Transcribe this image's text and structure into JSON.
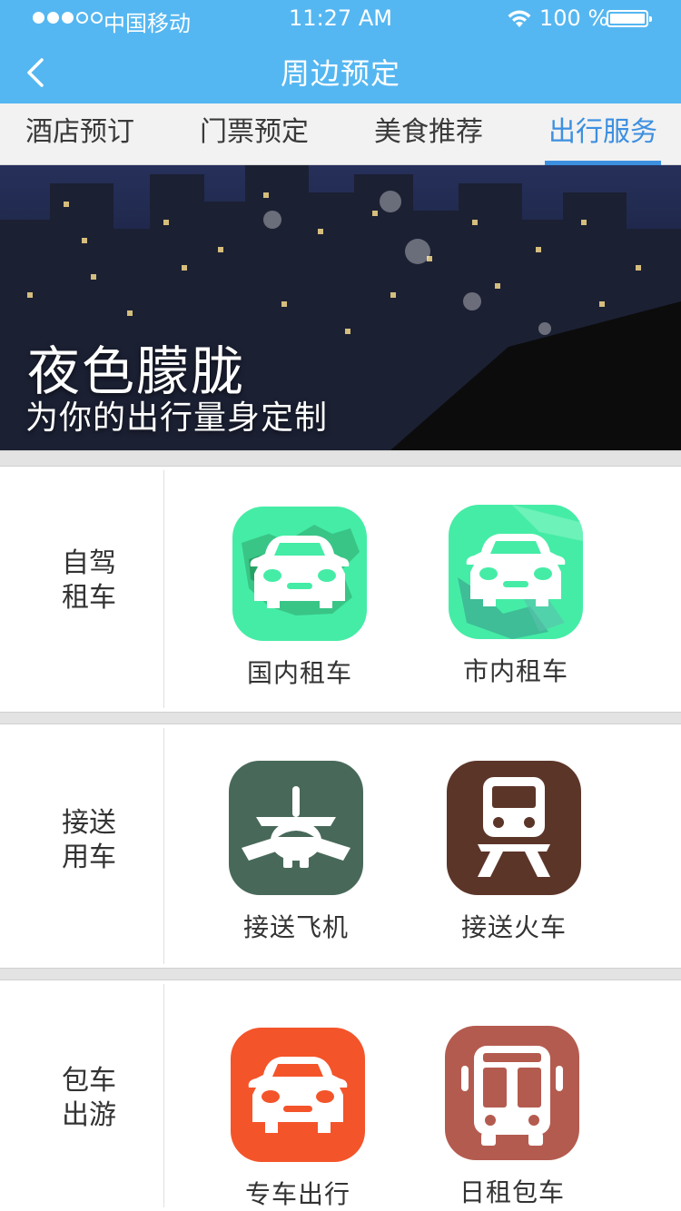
{
  "status": {
    "carrier": "中国移动",
    "time": "11:27 AM",
    "battery": "100 %"
  },
  "nav": {
    "title": "周边预定"
  },
  "tabs": [
    {
      "label": "酒店预订"
    },
    {
      "label": "门票预定"
    },
    {
      "label": "美食推荐"
    },
    {
      "label": "出行服务",
      "active": true
    }
  ],
  "banner": {
    "title": "夜色朦胧",
    "subtitle": "为你的出行量身定制"
  },
  "sections": [
    {
      "label_line1": "自驾",
      "label_line2": "租车",
      "items": [
        {
          "label": "国内租车",
          "icon": "car-map-icon",
          "color": "#45ECA6"
        },
        {
          "label": "市内租车",
          "icon": "car-city-map-icon",
          "color": "#45ECA6"
        }
      ]
    },
    {
      "label_line1": "接送",
      "label_line2": "用车",
      "items": [
        {
          "label": "接送飞机",
          "icon": "airplane-icon",
          "color": "#48695A"
        },
        {
          "label": "接送火车",
          "icon": "train-icon",
          "color": "#5C3529"
        }
      ]
    },
    {
      "label_line1": "包车",
      "label_line2": "出游",
      "items": [
        {
          "label": "专车出行",
          "icon": "car-icon",
          "color": "#F4542A"
        },
        {
          "label": "日租包车",
          "icon": "bus-icon",
          "color": "#B45B4F"
        }
      ]
    }
  ]
}
